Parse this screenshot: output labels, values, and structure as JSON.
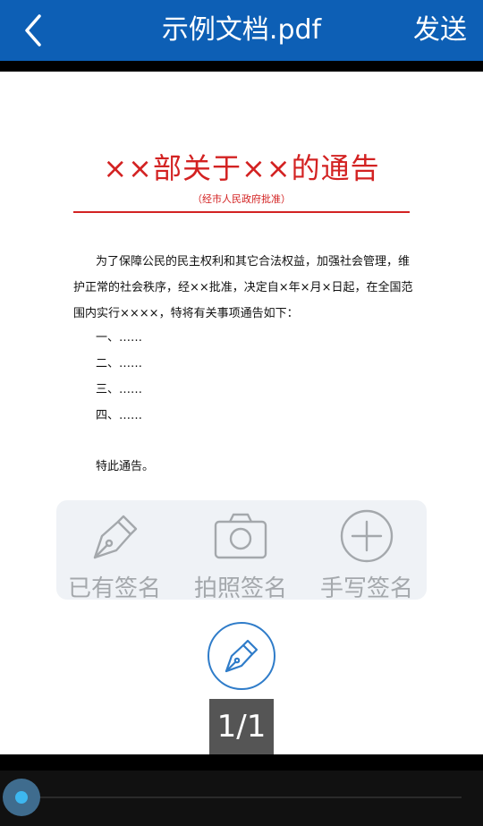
{
  "header": {
    "title": "示例文档.pdf",
    "send_label": "发送",
    "back_icon": "chevron-left-icon"
  },
  "document": {
    "title": "××部关于××的通告",
    "subtitle": "（经市人民政府批准）",
    "paragraph": "为了保障公民的民主权利和其它合法权益，加强社会管理，维护正常的社会秩序，经××批准，决定自×年×月×日起，在全国范围内实行××××，特将有关事项通告如下：",
    "list_items": [
      "一、……",
      "二、……",
      "三、……",
      "四、……"
    ],
    "closing": "特此通告。"
  },
  "sign_options": [
    {
      "label": "已有签名",
      "icon": "pen-nib-icon"
    },
    {
      "label": "拍照签名",
      "icon": "camera-icon"
    },
    {
      "label": "手写签名",
      "icon": "plus-circle-icon"
    }
  ],
  "fab_icon": "pen-nib-icon",
  "page_indicator": "1/1",
  "slider": {
    "progress": 0
  },
  "colors": {
    "header_bg": "#0D5FB5",
    "title_red": "#D32222",
    "accent_blue": "#2F7CC9",
    "slider_dot": "#3DB7F0"
  }
}
